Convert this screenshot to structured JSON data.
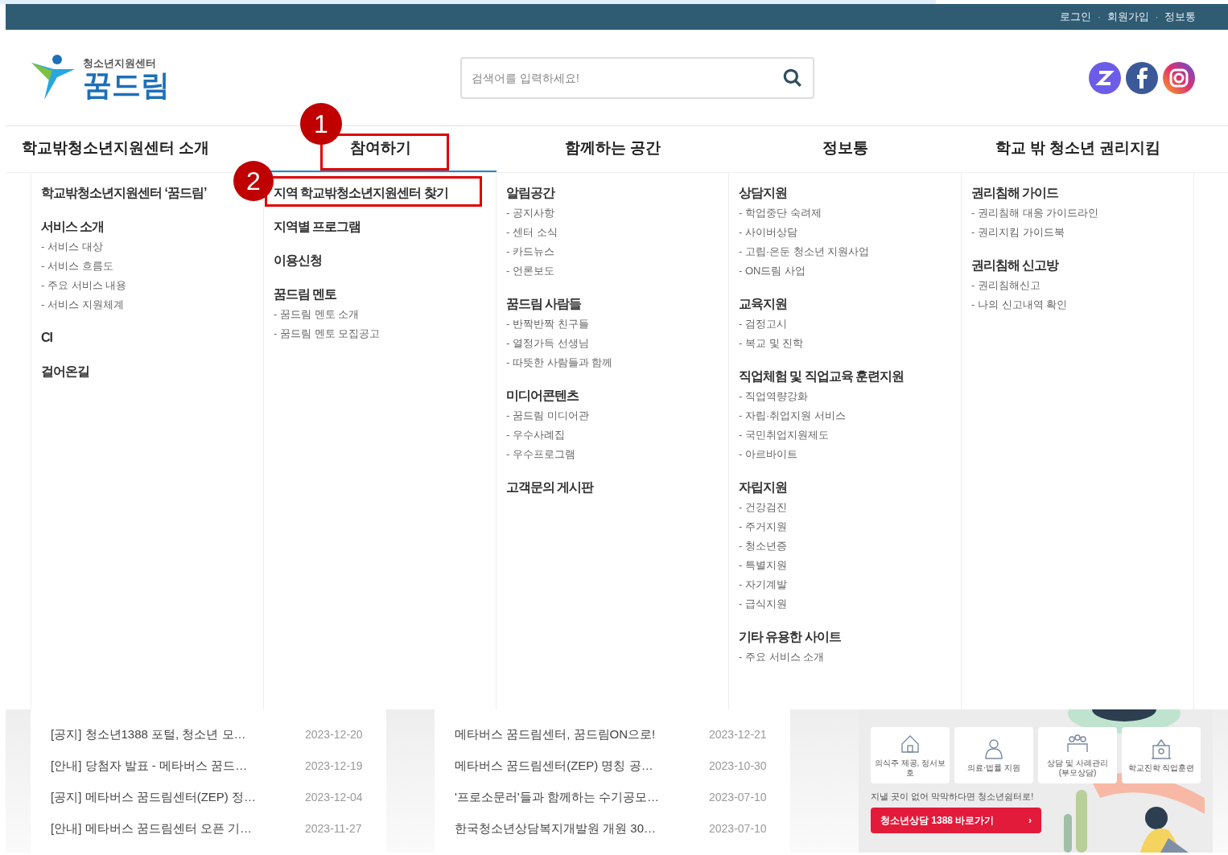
{
  "top_links": [
    "로그인",
    "회원가입",
    "정보통"
  ],
  "top_link_separator": "·",
  "item_bullet": "-",
  "logo": {
    "subtitle": "청소년지원센터",
    "title": "꿈드림"
  },
  "search": {
    "placeholder": "검색어를 입력하세요!"
  },
  "nav": [
    {
      "label": "학교밖청소년지원센터 소개",
      "selected": false
    },
    {
      "label": "참여하기",
      "selected": true
    },
    {
      "label": "함께하는 공간",
      "selected": false
    },
    {
      "label": "정보통",
      "selected": false
    },
    {
      "label": "학교 밖 청소년 권리지킴",
      "selected": false
    }
  ],
  "menu_columns": [
    [
      {
        "title": "학교밖청소년지원센터 ‘꿈드림’"
      },
      {
        "title": "서비스 소개",
        "items": [
          "서비스 대상",
          "서비스 흐름도",
          "주요 서비스 내용",
          "서비스 지원체계"
        ]
      },
      {
        "title": "CI"
      },
      {
        "title": "걸어온길"
      }
    ],
    [
      {
        "title": "지역 학교밖청소년지원센터 찾기"
      },
      {
        "title": "지역별 프로그램"
      },
      {
        "title": "이용신청"
      },
      {
        "title": "꿈드림 멘토",
        "items": [
          "꿈드림 멘토 소개",
          "꿈드림 멘토 모집공고"
        ]
      }
    ],
    [
      {
        "title": "알림공간",
        "items": [
          "공지사항",
          "센터 소식",
          "카드뉴스",
          "언론보도"
        ]
      },
      {
        "title": "꿈드림 사람들",
        "items": [
          "반짝반짝 친구들",
          "열정가득 선생님",
          "따뜻한 사람들과 함께"
        ]
      },
      {
        "title": "미디어콘텐츠",
        "items": [
          "꿈드림 미디어관",
          "우수사례집",
          "우수프로그램"
        ]
      },
      {
        "title": "고객문의 게시판"
      }
    ],
    [
      {
        "title": "상담지원",
        "items": [
          "학업중단 숙려제",
          "사이버상담",
          "고립·은둔 청소년 지원사업",
          "ON드림 사업"
        ]
      },
      {
        "title": "교육지원",
        "items": [
          "검정고시",
          "복교 및 진학"
        ]
      },
      {
        "title": "직업체험 및 직업교육 훈련지원",
        "items": [
          "직업역량강화",
          "자립·취업지원 서비스",
          "국민취업지원제도",
          "아르바이트"
        ]
      },
      {
        "title": "자립지원",
        "items": [
          "건강검진",
          "주거지원",
          "청소년증",
          "특별지원",
          "자기계발",
          "급식지원"
        ]
      },
      {
        "title": "기타 유용한 사이트",
        "items": [
          "주요 서비스 소개"
        ]
      }
    ],
    [
      {
        "title": "권리침해 가이드",
        "items": [
          "권리침해 대응 가이드라인",
          "권리지킴 가이드북"
        ]
      },
      {
        "title": "권리침해 신고방",
        "items": [
          "권리침해신고",
          "나의 신고내역 확인"
        ]
      }
    ]
  ],
  "annotations": [
    {
      "number": "1"
    },
    {
      "number": "2"
    }
  ],
  "notices": [
    [
      {
        "title": "[공지] 청소년1388 포털, 청소년 모…",
        "date": "2023-12-20"
      },
      {
        "title": "[안내] 당첨자 발표 - 메타버스 꿈드…",
        "date": "2023-12-19"
      },
      {
        "title": "[공지] 메타버스 꿈드림센터(ZEP) 정…",
        "date": "2023-12-04"
      },
      {
        "title": "[안내] 메타버스 꿈드림센터 오픈 기…",
        "date": "2023-11-27"
      }
    ],
    [
      {
        "title": "메타버스 꿈드림센터, 꿈드림ON으로!",
        "date": "2023-12-21"
      },
      {
        "title": "메타버스 꿈드림센터(ZEP) 명칭 공…",
        "date": "2023-10-30"
      },
      {
        "title": "'프로소문러'들과 함께하는 수기공모…",
        "date": "2023-07-10"
      },
      {
        "title": "한국청소년상담복지개발원 개원 30…",
        "date": "2023-07-10"
      }
    ]
  ],
  "banner": {
    "tiles": [
      "의식주 제공, 정서보호",
      "의료·법률 지원",
      "상담 및 사례관리 (부모상담)",
      "학교진학 직업훈련"
    ],
    "message": "지낼 곳이 없어 막막하다면 청소년쉼터로!",
    "button": "청소년상담 1388 바로가기",
    "arrow": "›"
  }
}
